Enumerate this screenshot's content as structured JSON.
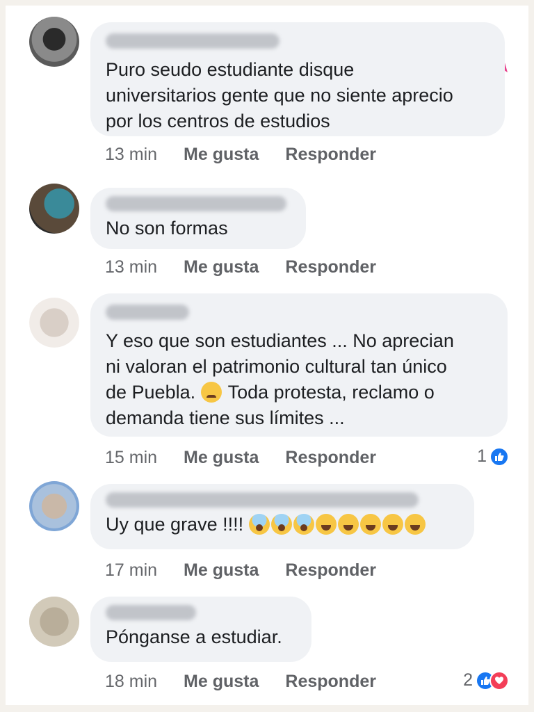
{
  "comments": [
    {
      "text": "Puro seudo estudiante disque\nuniversitarios gente que no siente aprecio\npor los centros de estudios",
      "time": "13 min",
      "like": "Me gusta",
      "reply": "Responder",
      "reactions": null
    },
    {
      "text": "No son formas",
      "time": "13 min",
      "like": "Me gusta",
      "reply": "Responder",
      "reactions": null
    },
    {
      "text_before_emoji": "Y eso que son estudiantes ... No aprecian\nni valoran el patrimonio cultural tan único\nde Puebla. ",
      "text_after_emoji": " Toda protesta, reclamo o\ndemanda tiene sus límites ...",
      "time": "15 min",
      "like": "Me gusta",
      "reply": "Responder",
      "reactions": {
        "count": "1",
        "types": [
          "like"
        ]
      }
    },
    {
      "text": "Uy que grave !!!! ",
      "emojis": [
        "fearful-face",
        "fearful-face",
        "fearful-face",
        "rolling-laughing",
        "rolling-laughing",
        "rolling-laughing",
        "rolling-laughing",
        "rolling-laughing"
      ],
      "time": "17 min",
      "like": "Me gusta",
      "reply": "Responder",
      "reactions": null
    },
    {
      "text": "Pónganse a estudiar.",
      "time": "18 min",
      "like": "Me gusta",
      "reply": "Responder",
      "reactions": {
        "count": "2",
        "types": [
          "like",
          "love"
        ]
      }
    }
  ],
  "colors": {
    "bubble": "#f0f2f5",
    "like_blue": "#1877f2",
    "love_red": "#f33e58",
    "logo_pink": "#e83e8c"
  },
  "logo": {
    "icon": "brand-logo-icon"
  }
}
